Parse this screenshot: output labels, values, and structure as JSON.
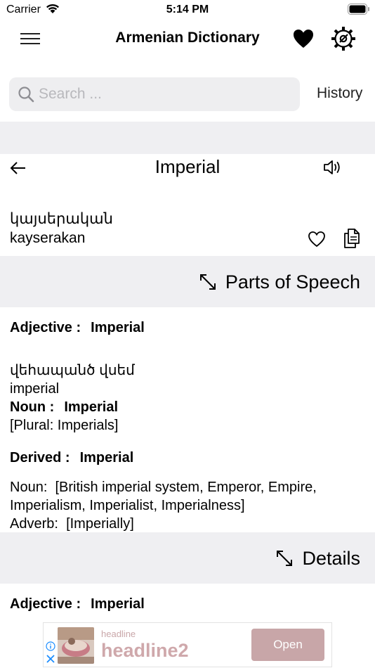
{
  "status_bar": {
    "carrier": "Carrier",
    "time": "5:14 PM"
  },
  "nav": {
    "title": "Armenian Dictionary",
    "icons": [
      "menu-icon",
      "heart-icon",
      "settings-gear-icon"
    ]
  },
  "search": {
    "placeholder": "Search ...",
    "value": "",
    "history_label": "History"
  },
  "word": {
    "title": "Imperial",
    "armenian": "կայսերական",
    "transliteration": "kayserakan"
  },
  "sections": {
    "parts_of_speech": {
      "label": "Parts of Speech"
    },
    "details": {
      "label": "Details"
    }
  },
  "parts_of_speech": {
    "adjective": {
      "label": "Adjective :",
      "value": "Imperial"
    },
    "armenian_line": "վեհապանծ վսեմ",
    "english_line": "imperial",
    "noun": {
      "label": "Noun :",
      "value": "Imperial",
      "plural": "[Plural: Imperials]"
    },
    "derived": {
      "label": "Derived :",
      "value": "Imperial",
      "noun_label": "Noun:",
      "noun_line1": "[British imperial system, Emperor, Empire,",
      "noun_line2": "Imperialism, Imperialist, Imperialness]",
      "adverb_label": "Adverb:",
      "adverb_value": "[Imperially]"
    }
  },
  "details": {
    "adjective": {
      "label": "Adjective :",
      "value": "Imperial"
    }
  },
  "ad": {
    "small": "headline",
    "big": "headline2",
    "button": "Open"
  },
  "colors": {
    "section_bg": "#efeff2",
    "search_bg": "#eeeef0",
    "ad_button": "#c8a6a8",
    "ad_text": "#cfa8ab"
  }
}
